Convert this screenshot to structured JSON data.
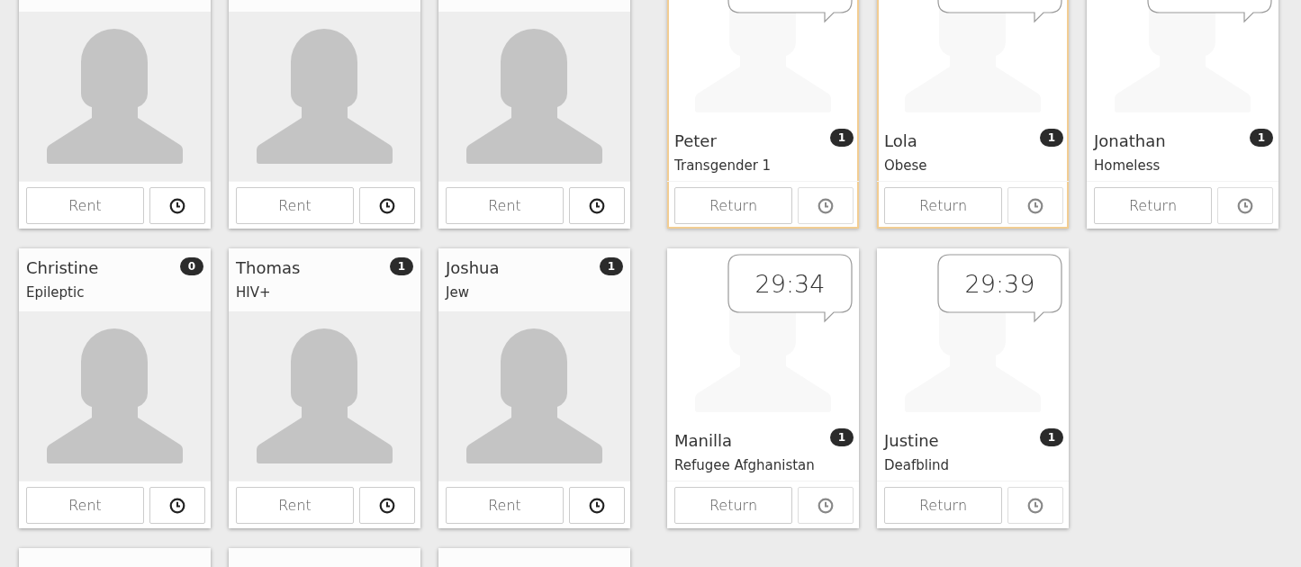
{
  "available_cards": [
    {
      "kind": "available",
      "highlighted": false,
      "action": "Rent"
    },
    {
      "kind": "available",
      "highlighted": false,
      "action": "Rent"
    },
    {
      "kind": "available",
      "highlighted": false,
      "action": "Rent"
    },
    {
      "kind": "available",
      "highlighted": false,
      "name": "Christine",
      "condition": "Epileptic",
      "badge": "0",
      "action": "Rent"
    },
    {
      "kind": "available",
      "highlighted": false,
      "name": "Thomas",
      "condition": "HIV+",
      "badge": "1",
      "action": "Rent"
    },
    {
      "kind": "available",
      "highlighted": false,
      "name": "Joshua",
      "condition": "Jew",
      "badge": "1",
      "action": "Rent"
    },
    {
      "kind": "available"
    },
    {
      "kind": "available"
    },
    {
      "kind": "available"
    }
  ],
  "rented_cards": [
    {
      "kind": "rented",
      "highlighted": true,
      "name": "Peter",
      "condition": "Transgender 1",
      "badge": "1",
      "action": "Return"
    },
    {
      "kind": "rented",
      "highlighted": true,
      "name": "Lola",
      "condition": "Obese",
      "badge": "1",
      "action": "Return"
    },
    {
      "kind": "rented",
      "highlighted": false,
      "name": "Jonathan",
      "condition": "Homeless",
      "badge": "1",
      "action": "Return"
    },
    {
      "kind": "rented",
      "highlighted": false,
      "timer": "29:34",
      "name": "Manilla",
      "condition": "Refugee Afghanistan",
      "badge": "1",
      "action": "Return"
    },
    {
      "kind": "rented",
      "highlighted": false,
      "timer": "29:39",
      "name": "Justine",
      "condition": "Deafblind",
      "badge": "1",
      "action": "Return"
    }
  ]
}
